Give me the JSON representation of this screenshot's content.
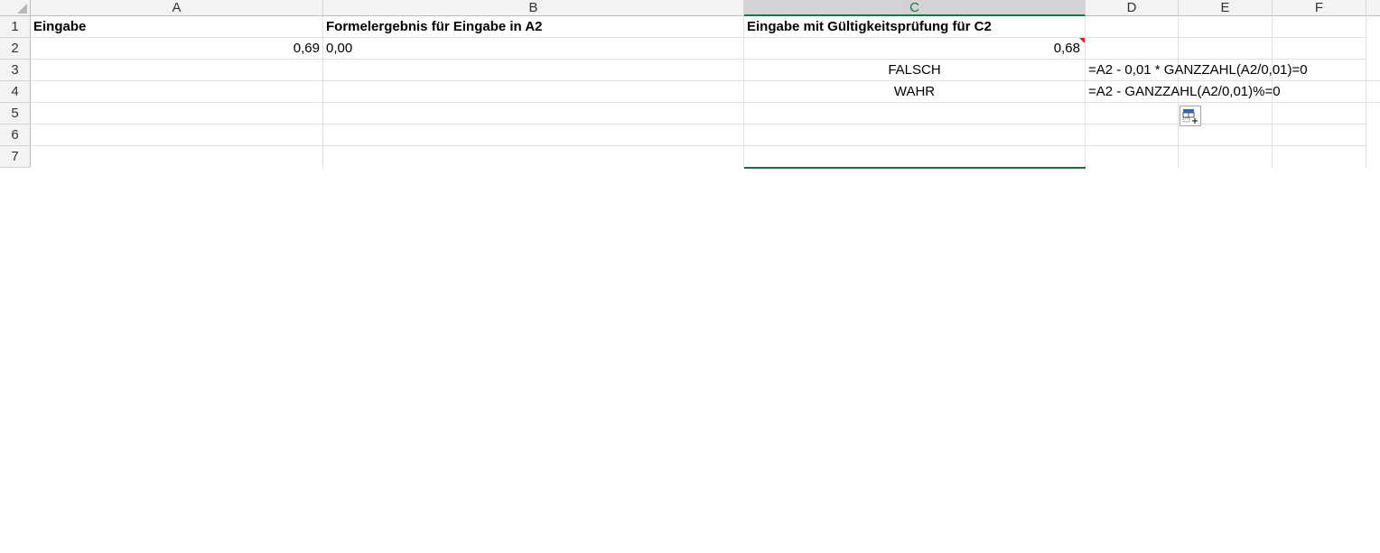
{
  "columns": [
    "A",
    "B",
    "C",
    "D",
    "E",
    "F"
  ],
  "selected_column": "C",
  "rows": [
    "1",
    "2",
    "3",
    "4",
    "5",
    "6",
    "7"
  ],
  "cells": {
    "A1": "Eingabe",
    "B1": "Formelergebnis für Eingabe in A2",
    "C1": "Eingabe mit Gültigkeitsprüfung für C2",
    "A2": "0,69",
    "B2": "0,00",
    "C2": "0,68",
    "C3": "FALSCH",
    "D3": "=A2 - 0,01 * GANZZAHL(A2/0,01)=0",
    "C4": "WAHR",
    "D4": "=A2 - GANZZAHL(A2/0,01)%=0"
  },
  "icons": {
    "comment_indicator": "comment-indicator-icon",
    "quick_analysis": "quick-analysis-icon"
  },
  "colors": {
    "selection_accent": "#107c41",
    "comment_indicator": "#e0241b"
  }
}
